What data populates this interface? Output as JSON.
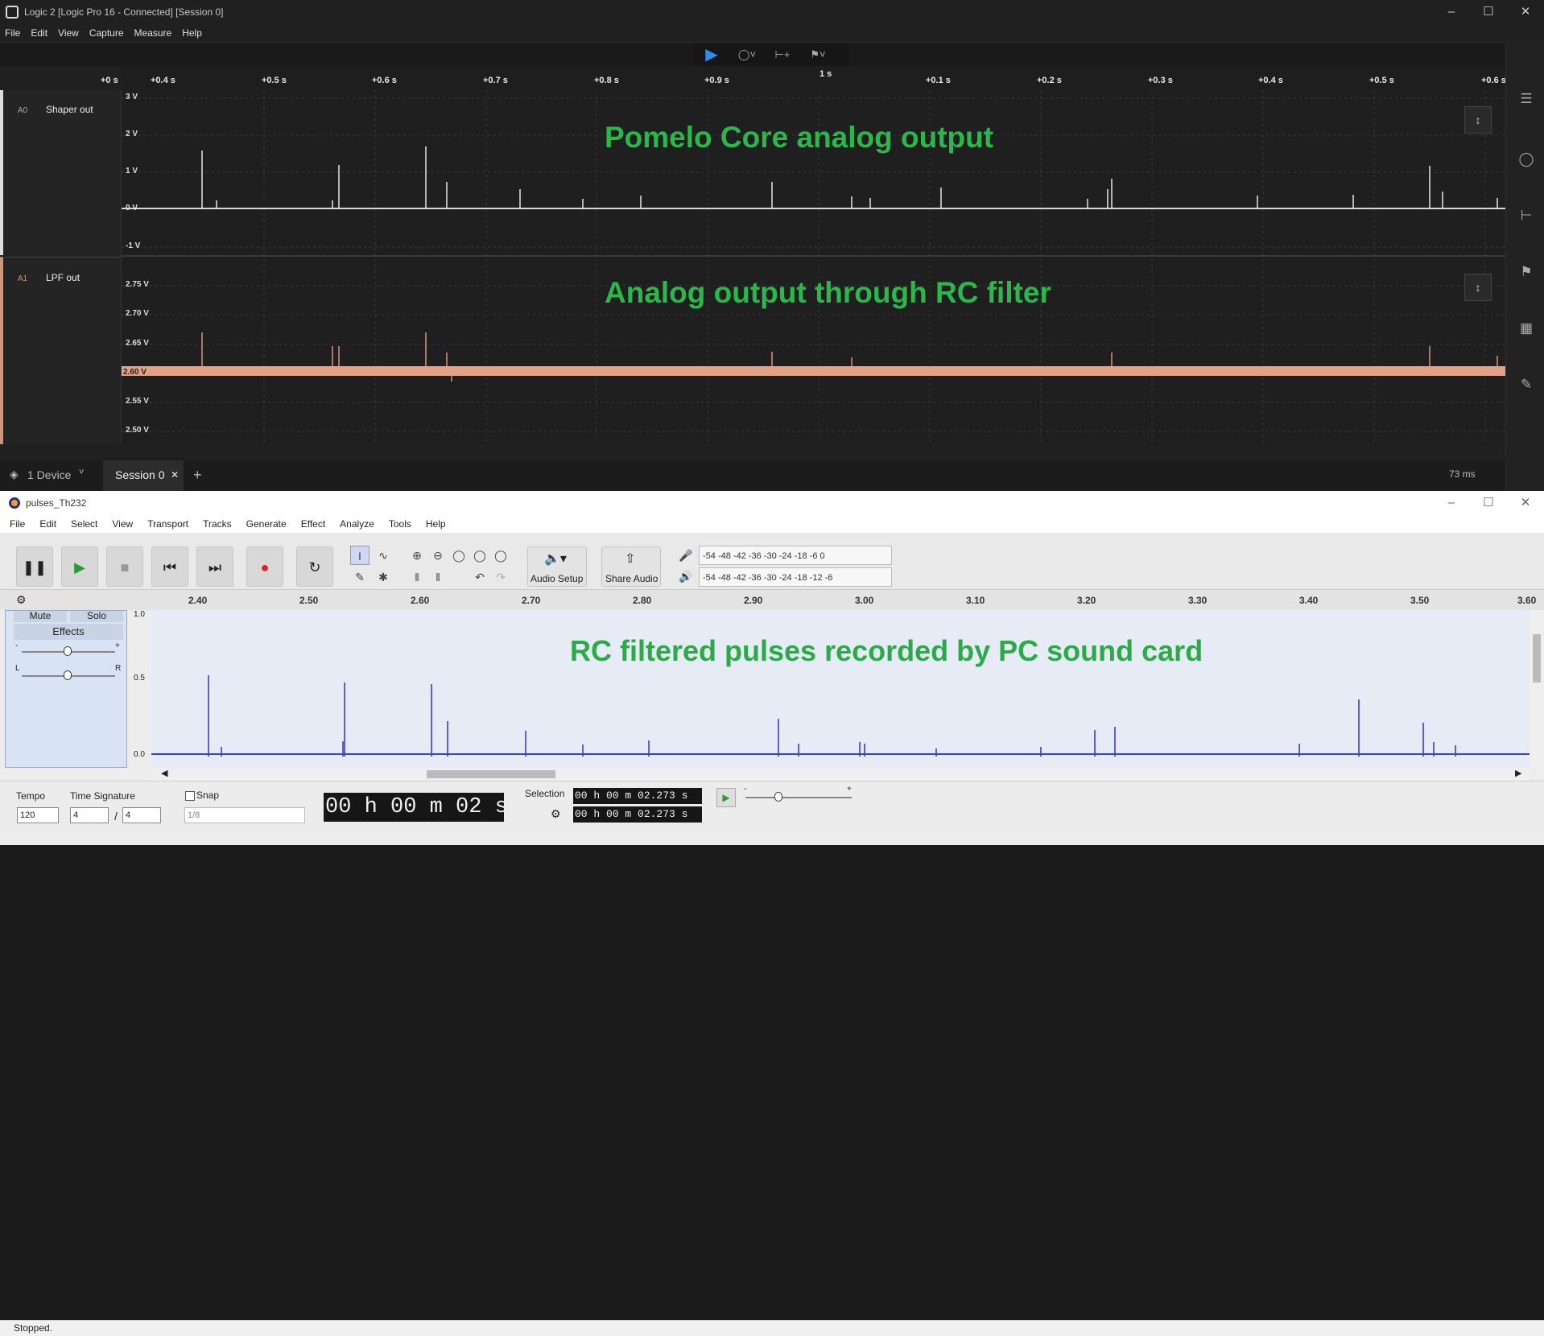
{
  "logic": {
    "title": "Logic 2 [Logic Pro 16 - Connected] [Session 0]",
    "menu": [
      "File",
      "Edit",
      "View",
      "Capture",
      "Measure",
      "Help"
    ],
    "time_ticks": [
      "+0 s",
      "+0.4 s",
      "+0.5 s",
      "+0.6 s",
      "+0.7 s",
      "+0.8 s",
      "+0.9 s",
      "+0.1 s",
      "+0.2 s",
      "+0.3 s",
      "+0.4 s",
      "+0.5 s",
      "+0.6 s"
    ],
    "time_major": "1 s",
    "channels": [
      {
        "id": "A0",
        "name": "Shaper out",
        "y_labels": [
          "3 V",
          "2 V",
          "1 V",
          "0 V",
          "-1 V"
        ],
        "overlay": "Pomelo Core analog output"
      },
      {
        "id": "A1",
        "name": "LPF out",
        "y_labels": [
          "2.75 V",
          "2.70 V",
          "2.65 V",
          "2.60 V",
          "2.55 V",
          "2.50 V"
        ],
        "overlay": "Analog output through RC filter"
      }
    ],
    "device_label": "1 Device",
    "session_tab": "Session 0",
    "add_tab": "+",
    "latency": "73 ms"
  },
  "audacity": {
    "title": "pulses_Th232",
    "menu": [
      "File",
      "Edit",
      "Select",
      "View",
      "Transport",
      "Tracks",
      "Generate",
      "Effect",
      "Analyze",
      "Tools",
      "Help"
    ],
    "audio_setup_label": "Audio Setup",
    "share_audio_label": "Share Audio",
    "meter_scale_record": "-54 -48 -42 -36 -30 -24 -18  -6  0",
    "meter_scale_play": "-54 -48 -42 -36 -30 -24 -18 -12 -6",
    "ruler_ticks": [
      "2.40",
      "2.50",
      "2.60",
      "2.70",
      "2.80",
      "2.90",
      "3.00",
      "3.10",
      "3.20",
      "3.30",
      "3.40",
      "3.50",
      "3.60"
    ],
    "track": {
      "mute": "Mute",
      "solo": "Solo",
      "effects": "Effects",
      "gain_minus": "-",
      "gain_plus": "+",
      "pan_l": "L",
      "pan_r": "R"
    },
    "y_labels": [
      "1.0",
      "0.5",
      "0.0"
    ],
    "overlay": "RC filtered pulses recorded by PC sound card",
    "tempo_label": "Tempo",
    "tempo_value": "120",
    "timesig_label": "Time Signature",
    "timesig_num": "4",
    "timesig_sep": "/",
    "timesig_den": "4",
    "snap_label": "Snap",
    "snap_value": "1/8",
    "time_display": "00 h 00 m 02 s",
    "selection_label": "Selection",
    "selection_start": "00 h 00 m 02.273 s",
    "selection_end": "00 h 00 m 02.273 s",
    "speed_minus": "-",
    "speed_plus": "+",
    "status": "Stopped."
  }
}
